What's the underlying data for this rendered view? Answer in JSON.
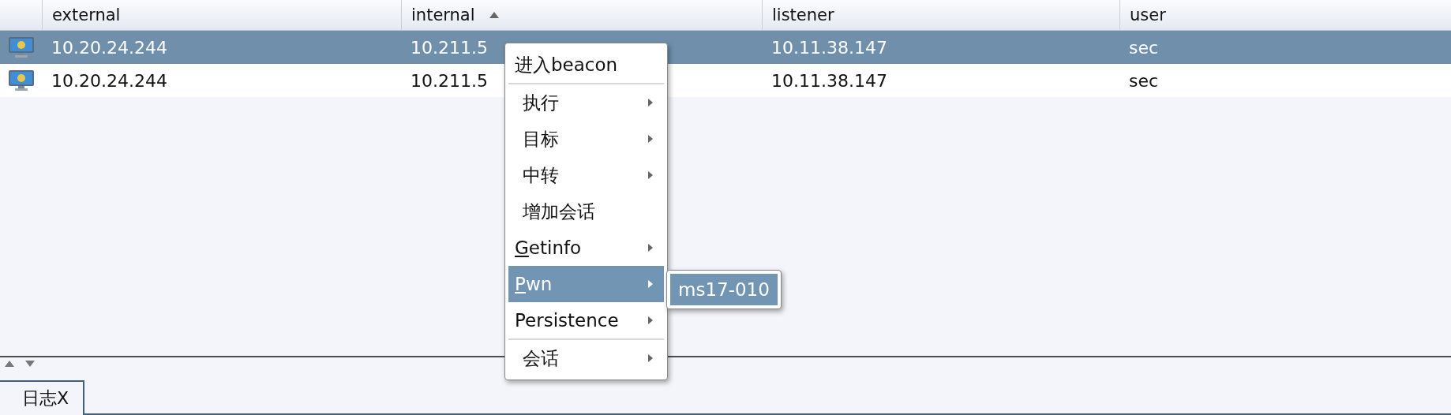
{
  "table": {
    "columns": [
      {
        "label": "external",
        "sorted": false
      },
      {
        "label": "internal",
        "sorted": true
      },
      {
        "label": "listener",
        "sorted": false
      },
      {
        "label": "user",
        "sorted": false
      }
    ],
    "rows": [
      {
        "selected": true,
        "cells": [
          "10.20.24.244",
          "10.211.5",
          "10.11.38.147",
          "sec"
        ]
      },
      {
        "selected": false,
        "cells": [
          "10.20.24.244",
          "10.211.5",
          "10.11.38.147",
          "sec"
        ]
      }
    ]
  },
  "context_menu": {
    "items": [
      {
        "label": "进入beacon",
        "indented": false,
        "underline_first": false,
        "submenu": false,
        "selected": false,
        "separator_after": true
      },
      {
        "label": "执行",
        "indented": true,
        "underline_first": false,
        "submenu": true,
        "selected": false,
        "separator_after": false
      },
      {
        "label": "目标",
        "indented": true,
        "underline_first": false,
        "submenu": true,
        "selected": false,
        "separator_after": false
      },
      {
        "label": "中转",
        "indented": true,
        "underline_first": false,
        "submenu": true,
        "selected": false,
        "separator_after": false
      },
      {
        "label": "增加会话",
        "indented": true,
        "underline_first": false,
        "submenu": false,
        "selected": false,
        "separator_after": false
      },
      {
        "label": "Getinfo",
        "indented": false,
        "underline_first": true,
        "submenu": true,
        "selected": false,
        "separator_after": false
      },
      {
        "label": "Pwn",
        "indented": false,
        "underline_first": true,
        "submenu": true,
        "selected": true,
        "separator_after": false
      },
      {
        "label": "Persistence",
        "indented": false,
        "underline_first": false,
        "submenu": true,
        "selected": false,
        "separator_after": true
      },
      {
        "label": "会话",
        "indented": true,
        "underline_first": false,
        "submenu": true,
        "selected": false,
        "separator_after": false
      }
    ]
  },
  "submenu": {
    "items": [
      {
        "label": "ms17-010",
        "selected": true
      }
    ]
  },
  "tabs": [
    {
      "label": "日志X",
      "selected": true
    }
  ]
}
